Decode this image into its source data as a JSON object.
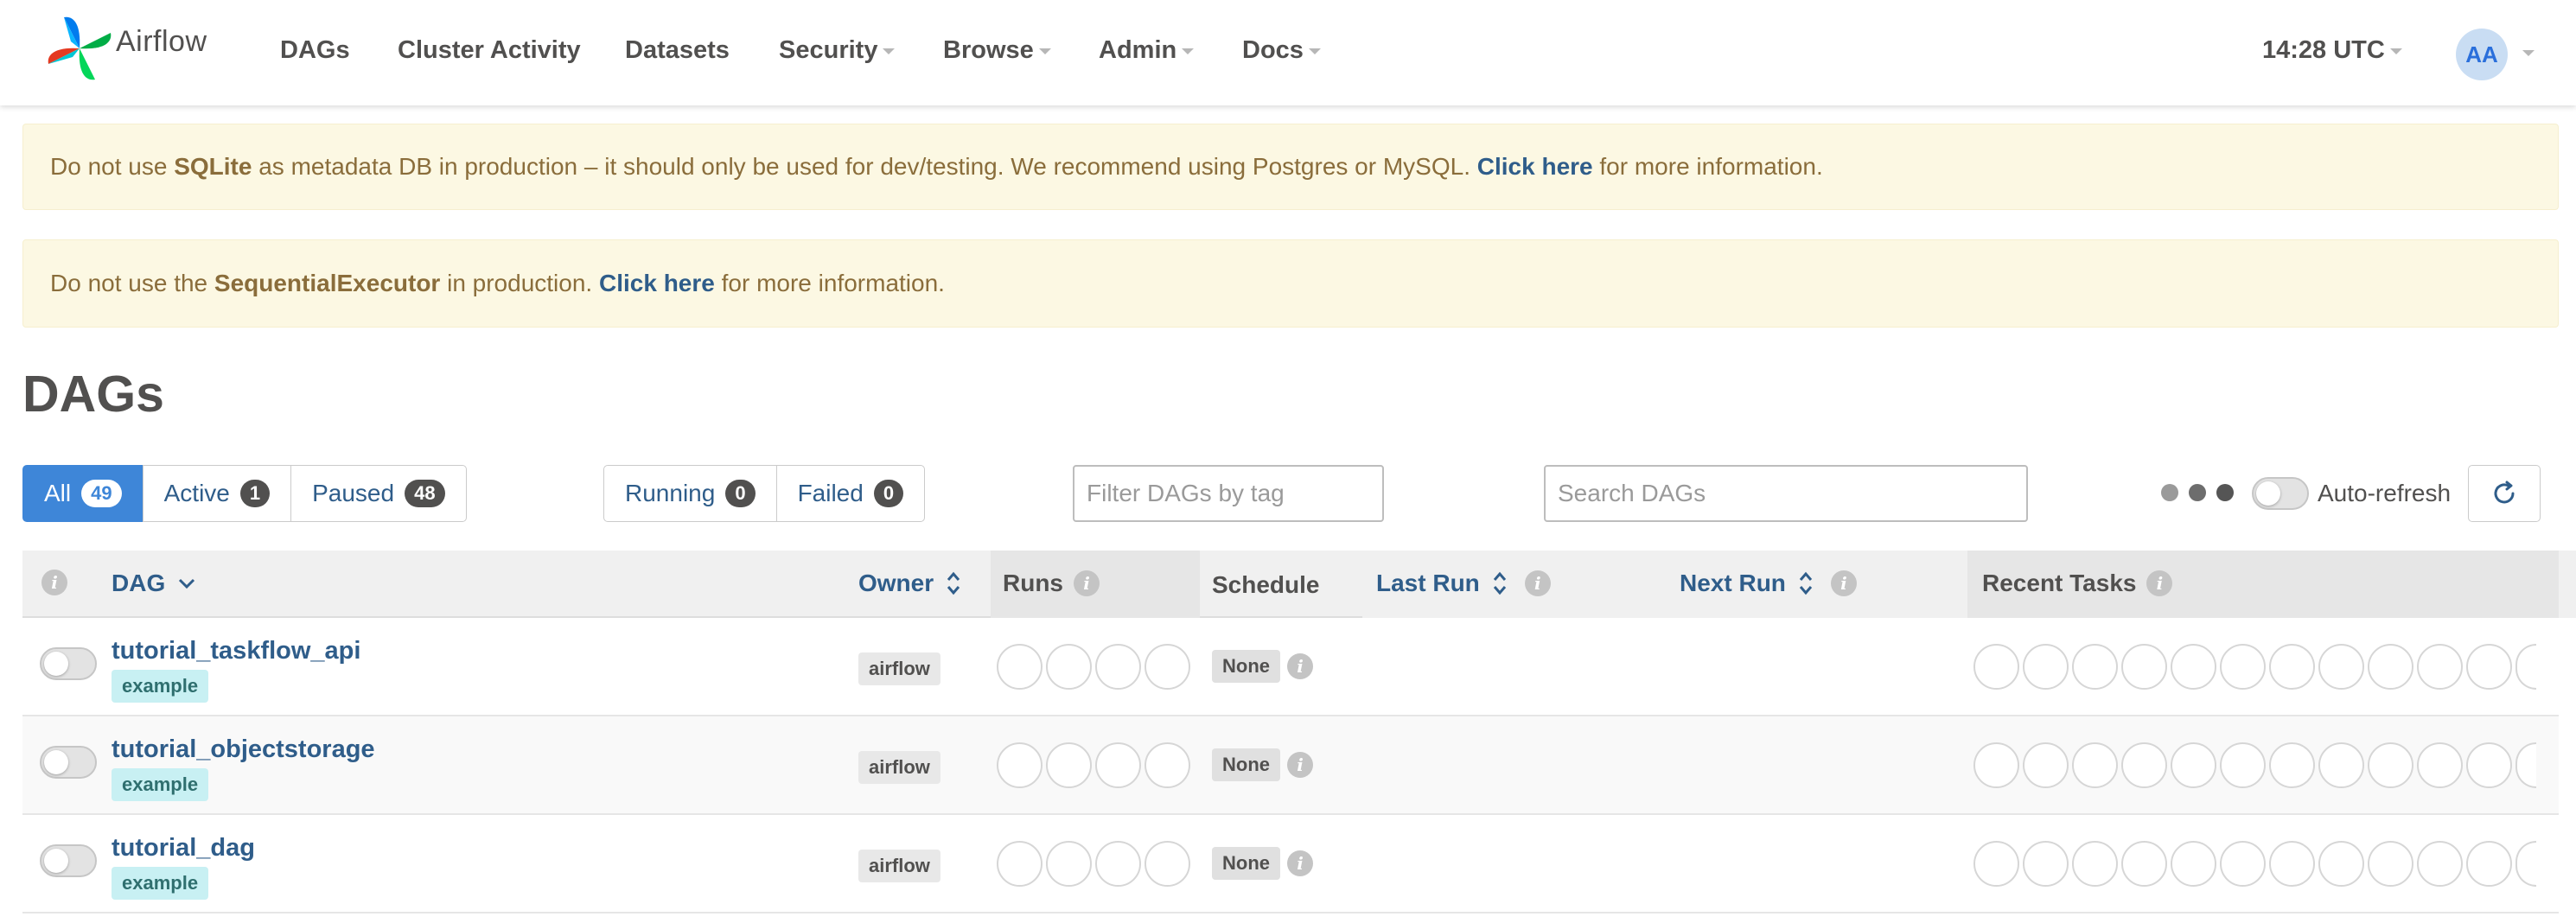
{
  "brand": {
    "name": "Airflow"
  },
  "nav": {
    "items": [
      {
        "label": "DAGs",
        "dropdown": false
      },
      {
        "label": "Cluster Activity",
        "dropdown": false
      },
      {
        "label": "Datasets",
        "dropdown": false
      },
      {
        "label": "Security",
        "dropdown": true
      },
      {
        "label": "Browse",
        "dropdown": true
      },
      {
        "label": "Admin",
        "dropdown": true
      },
      {
        "label": "Docs",
        "dropdown": true
      }
    ],
    "time": "14:28 UTC",
    "user_initials": "AA"
  },
  "alerts": [
    {
      "pre": "Do not use ",
      "bold": "SQLite",
      "mid": " as metadata DB in production – it should only be used for dev/testing. We recommend using Postgres or MySQL. ",
      "link": "Click here",
      "post": " for more information."
    },
    {
      "pre": "Do not use the ",
      "bold": "SequentialExecutor",
      "mid": " in production. ",
      "link": "Click here",
      "post": " for more information."
    }
  ],
  "page_title": "DAGs",
  "status_filters": [
    {
      "label": "All",
      "count": "49",
      "active": true
    },
    {
      "label": "Active",
      "count": "1",
      "active": false
    },
    {
      "label": "Paused",
      "count": "48",
      "active": false
    }
  ],
  "run_filters": [
    {
      "label": "Running",
      "count": "0"
    },
    {
      "label": "Failed",
      "count": "0"
    }
  ],
  "tag_filter": {
    "placeholder": "Filter DAGs by tag"
  },
  "search": {
    "placeholder": "Search DAGs"
  },
  "auto_refresh_label": "Auto-refresh",
  "table": {
    "headers": {
      "dag": "DAG",
      "owner": "Owner",
      "runs": "Runs",
      "schedule": "Schedule",
      "last_run": "Last Run",
      "next_run": "Next Run",
      "recent_tasks": "Recent Tasks"
    },
    "rows": [
      {
        "name": "tutorial_taskflow_api",
        "tag": "example",
        "owner": "airflow",
        "schedule": "None"
      },
      {
        "name": "tutorial_objectstorage",
        "tag": "example",
        "owner": "airflow",
        "schedule": "None"
      },
      {
        "name": "tutorial_dag",
        "tag": "example",
        "owner": "airflow",
        "schedule": "None"
      }
    ]
  },
  "colors": {
    "primary": "#3e86d8",
    "link": "#2f5d8a",
    "alert_bg": "#fcf8e3",
    "alert_text": "#8a6d3b",
    "tag_bg": "#c8f0f3"
  }
}
